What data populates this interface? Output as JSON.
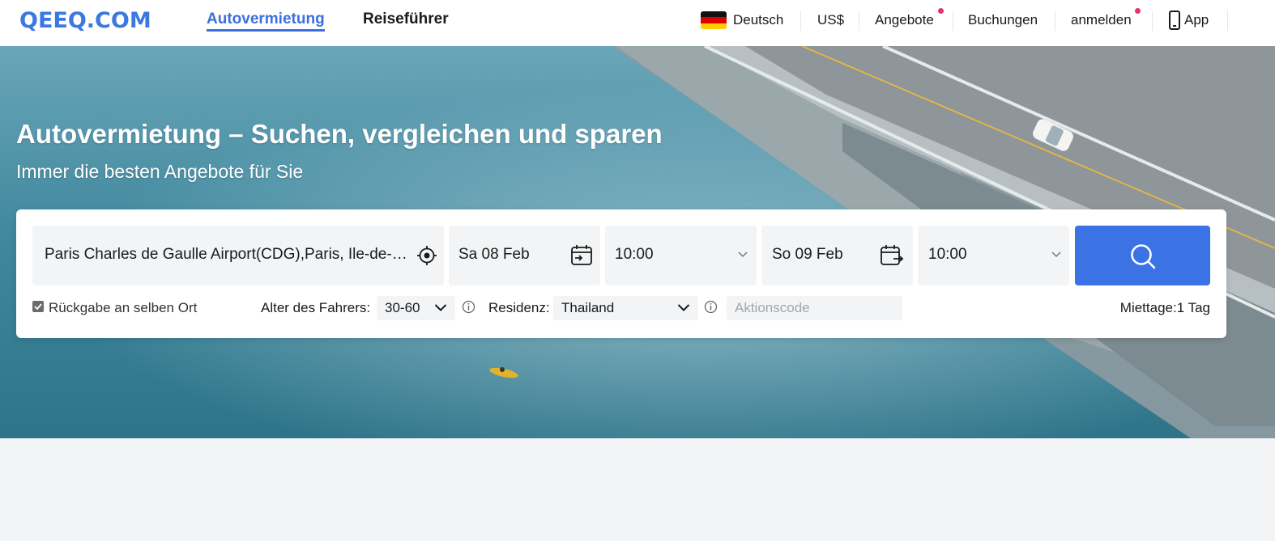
{
  "header": {
    "logo": "QEEQ.COM",
    "tabs": [
      {
        "label": "Autovermietung",
        "active": true
      },
      {
        "label": "Reiseführer",
        "active": false
      }
    ],
    "language": "Deutsch",
    "currency": "US$",
    "offers": "Angebote",
    "bookings": "Buchungen",
    "login": "anmelden",
    "app": "App"
  },
  "hero": {
    "title": "Autovermietung – Suchen, vergleichen und sparen",
    "subtitle": "Immer die besten Angebote für Sie"
  },
  "search": {
    "location": "Paris Charles de Gaulle Airport(CDG),Paris, Ile-de-France, France",
    "pickup_date": "Sa 08 Feb",
    "pickup_time": "10:00",
    "return_date": "So 09 Feb",
    "return_time": "10:00",
    "same_return_label": "Rückgabe an selben Ort",
    "same_return_checked": true,
    "driver_age_label": "Alter des Fahrers:",
    "driver_age": "30-60",
    "residence_label": "Residenz:",
    "residence": "Thailand",
    "promo_placeholder": "Aktionscode",
    "rental_days": "Miettage:1 Tag"
  },
  "colors": {
    "accent": "#3b73e4",
    "notification_dot": "#e8336a"
  }
}
